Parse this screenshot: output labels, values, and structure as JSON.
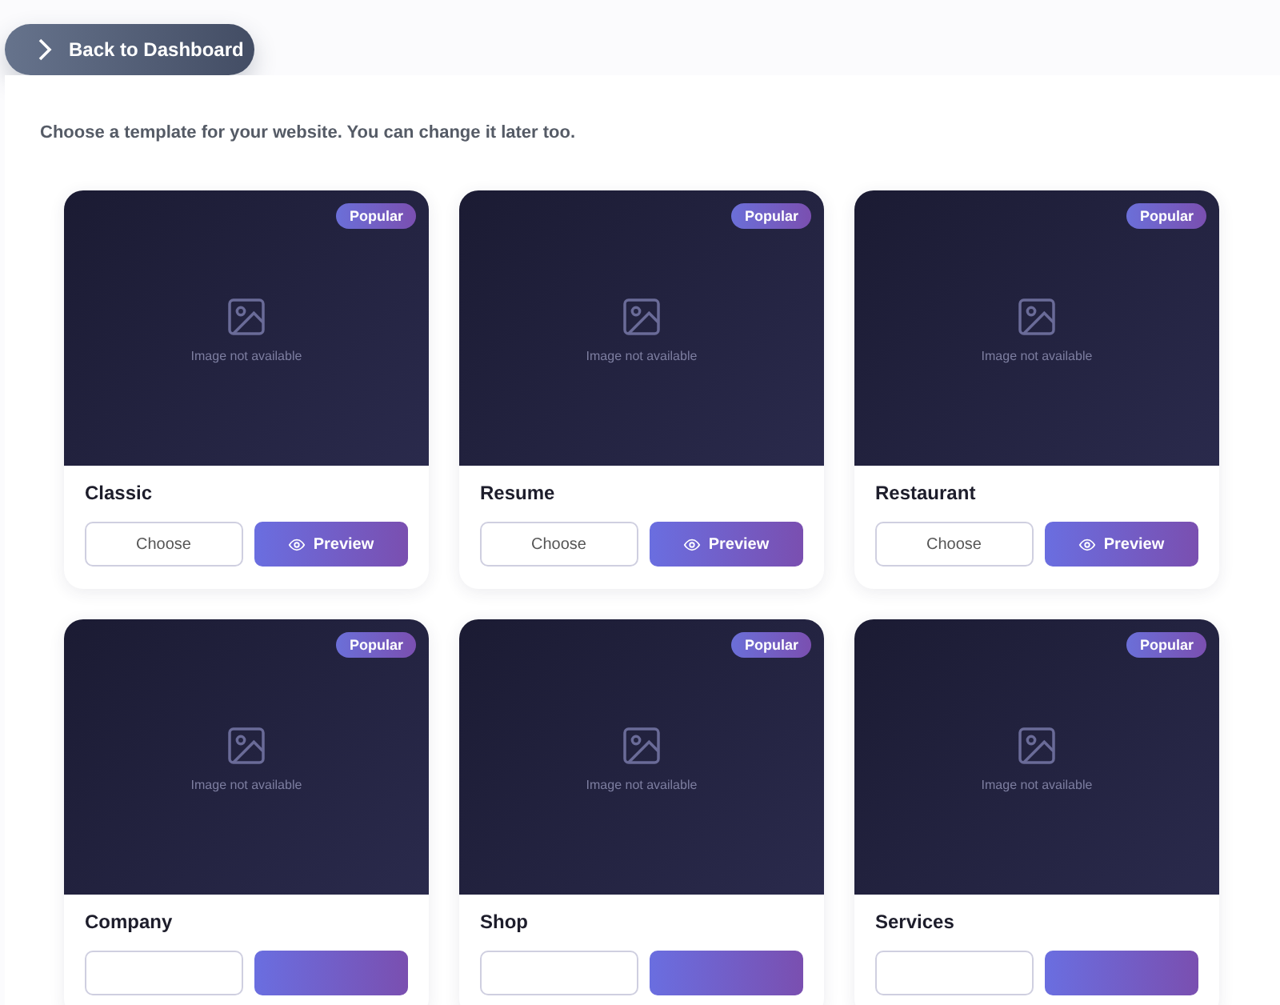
{
  "back_button": {
    "label": "Back to Dashboard"
  },
  "intro": "Choose a template for your website. You can change it later too.",
  "templates": [
    {
      "name": "Classic",
      "badge": "Popular",
      "placeholder_text": "Image not available",
      "choose_label": "Choose",
      "preview_label": "Preview"
    },
    {
      "name": "Resume",
      "badge": "Popular",
      "placeholder_text": "Image not available",
      "choose_label": "Choose",
      "preview_label": "Preview"
    },
    {
      "name": "Restaurant",
      "badge": "Popular",
      "placeholder_text": "Image not available",
      "choose_label": "Choose",
      "preview_label": "Preview"
    },
    {
      "name": "Company",
      "badge": "Popular",
      "placeholder_text": "Image not available"
    },
    {
      "name": "Shop",
      "badge": "Popular",
      "placeholder_text": "Image not available"
    },
    {
      "name": "Services",
      "badge": "Popular",
      "placeholder_text": "Image not available"
    }
  ]
}
